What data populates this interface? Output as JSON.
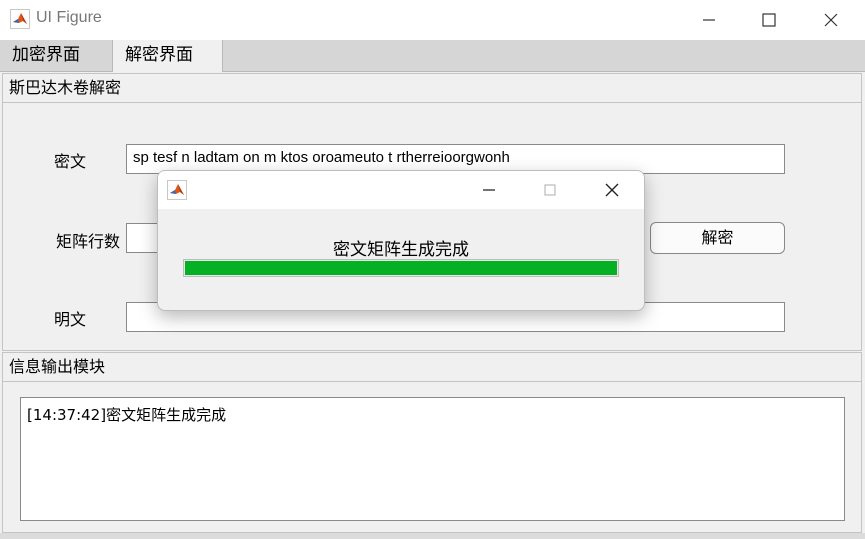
{
  "window": {
    "title": "UI Figure"
  },
  "tabs": [
    {
      "label": "加密界面",
      "active": false
    },
    {
      "label": "解密界面",
      "active": true
    }
  ],
  "decrypt_panel": {
    "header": "斯巴达木卷解密",
    "ciphertext_label": "密文",
    "ciphertext_value": "sp tesf n ladtam on m ktos oroameuto t rtherreioorgwonh",
    "rows_label": "矩阵行数",
    "rows_value": "",
    "decrypt_button": "解密",
    "plaintext_label": "明文",
    "plaintext_value": ""
  },
  "log_panel": {
    "header": "信息输出模块",
    "log_text": "[14:37:42]密文矩阵生成完成"
  },
  "progress_dialog": {
    "message": "密文矩阵生成完成",
    "progress": 1.0,
    "bar_color": "#06b025"
  },
  "icons": {
    "app": "matlab-logo-icon",
    "minimize": "minimize-icon",
    "maximize": "maximize-icon",
    "close": "close-icon"
  }
}
